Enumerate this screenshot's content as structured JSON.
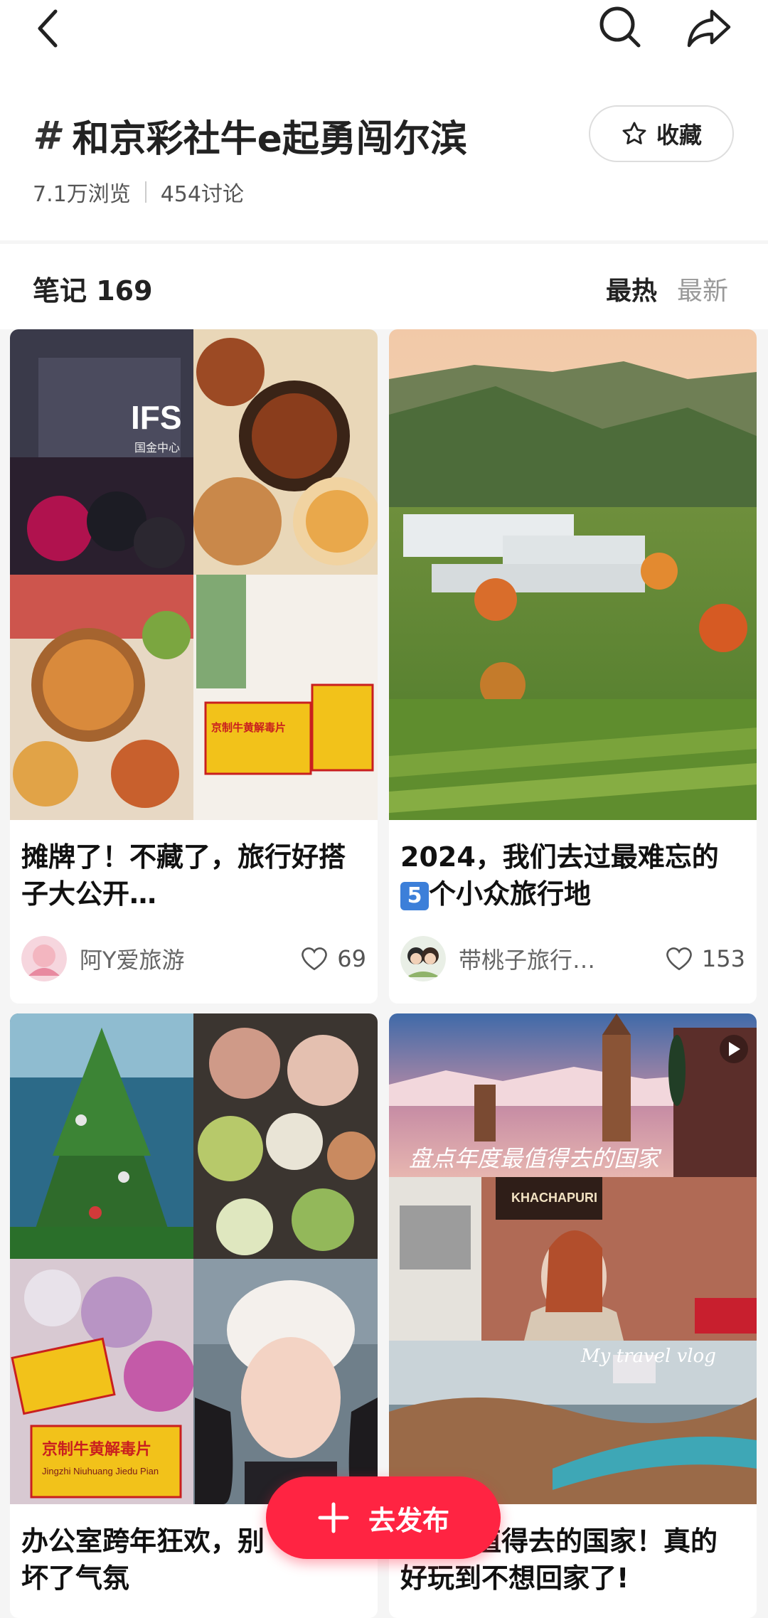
{
  "header": {
    "title": "和京彩社牛e起勇闯尔滨",
    "hash_symbol": "#",
    "favorite_label": "收藏",
    "views": "7.1万浏览",
    "discussions": "454讨论"
  },
  "notes_bar": {
    "count_label": "笔记 169",
    "sort_hot": "最热",
    "sort_new": "最新"
  },
  "cards": [
    {
      "title_line1": "摊牌了！不藏了，旅行好搭",
      "title_line2": "子大公开…",
      "author": "阿Y爱旅游",
      "likes": "69",
      "photo_text_1": "IFS",
      "photo_text_2": "国金中心",
      "photo_text_3": "京制牛黄解毒片"
    },
    {
      "title_line1": "2024，我们去过最难忘的",
      "title_badge": "5",
      "title_line2": "个小众旅行地",
      "author": "带桃子旅行…",
      "likes": "153"
    },
    {
      "title_line1": "办公室跨年狂欢，别",
      "title_line2": "坏了气氛",
      "photo_text_1": "京制牛黄解毒片",
      "photo_text_2": "Jingzhi Niuhuang Jiedu Pian"
    },
    {
      "title_line1": "值得去的国家！真的",
      "title_line2": "好玩到不想回家了!",
      "photo_text_1": "盘点年度最值得去的国家",
      "photo_text_2": "My travel vlog",
      "photo_text_3": "KHACHAPURI"
    }
  ],
  "post_button": {
    "label": "去发布"
  },
  "colors": {
    "accent": "#ff2442"
  }
}
